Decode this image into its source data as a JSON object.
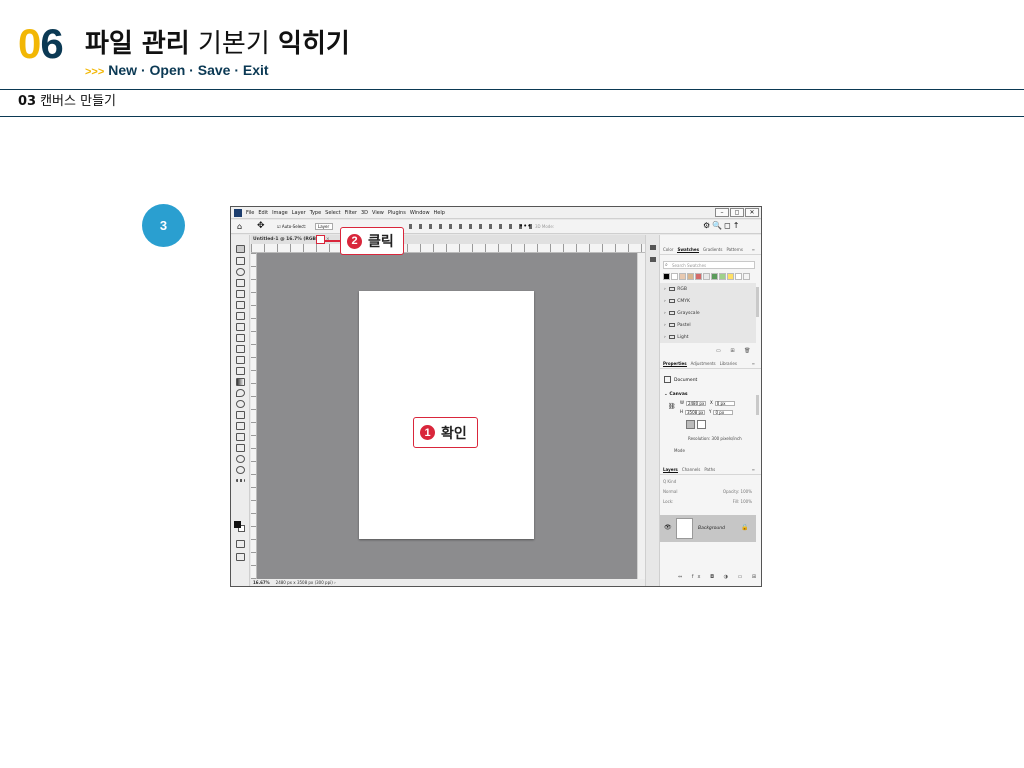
{
  "chapter": {
    "number_first": "0",
    "number_second": "6",
    "title_bold": "파일 관리",
    "title_light": "기본기",
    "title_bold2": "익히기",
    "sub_arrows": ">>>",
    "subtitle": "New · Open · Save · Exit"
  },
  "section": {
    "number": "03",
    "title": "캔버스 만들기"
  },
  "step": {
    "number": "3"
  },
  "app": {
    "menu": [
      "File",
      "Edit",
      "Image",
      "Layer",
      "Type",
      "Select",
      "Filter",
      "3D",
      "View",
      "Plugins",
      "Window",
      "Help"
    ],
    "window_controls": [
      "–",
      "◻",
      "✕"
    ],
    "options": {
      "auto_select": "☑ Auto-Select:",
      "layer_select": "Layer",
      "more": "•••",
      "mode_3d": "3D Mode:",
      "right_icons": "⚙🔍◻↑"
    },
    "document_tab": "Untitled-1 @ 16.7% (RGB/8)",
    "document_tab_close": "×",
    "status": {
      "zoom": "16.67%",
      "size": "2480 px x 3508 px (300 ppi)",
      "arrow": "›"
    },
    "swatches_tabs": [
      "Color",
      "Swatches",
      "Gradients",
      "Patterns"
    ],
    "swatches_active": "Swatches",
    "swatch_search": "Search Swatches",
    "swatch_colors": [
      "#000000",
      "#ffffff",
      "#e8c9b0",
      "#d9b78f",
      "#d46a6a",
      "#e9e9e9",
      "#5b9b5b",
      "#9fd18b",
      "#ffe066",
      "#ffffff",
      "#f5f5f5"
    ],
    "swatch_groups": [
      "RGB",
      "CMYK",
      "Grayscale",
      "Pastel",
      "Light"
    ],
    "properties_tabs": [
      "Properties",
      "Adjustments",
      "Libraries"
    ],
    "properties_active": "Properties",
    "properties": {
      "document": "Document",
      "canvas": "Canvas",
      "w_label": "W",
      "w_value": "2480 px",
      "h_label": "H",
      "h_value": "3508 px",
      "x_label": "X",
      "x_value": "0 px",
      "y_label": "Y",
      "y_value": "0 px",
      "resolution": "Resolution: 300 pixels/inch",
      "mode": "Mode"
    },
    "layers_tabs": [
      "Layers",
      "Channels",
      "Paths"
    ],
    "layers_active": "Layers",
    "layers": {
      "filter": "Q Kind",
      "blend": "Normal",
      "opacity": "Opacity: 100%",
      "lock": "Lock:",
      "fill": "Fill: 100%",
      "layer_name": "Background"
    }
  },
  "callouts": {
    "click_number": "2",
    "click_text": "클릭",
    "ok_number": "1",
    "ok_text": "확인"
  },
  "colors": {
    "accent_yellow": "#f2b705",
    "navy": "#0b3954",
    "step_blue": "#2a9fd0",
    "callout_red": "#d9263b",
    "canvas_gray": "#8c8c8e"
  }
}
